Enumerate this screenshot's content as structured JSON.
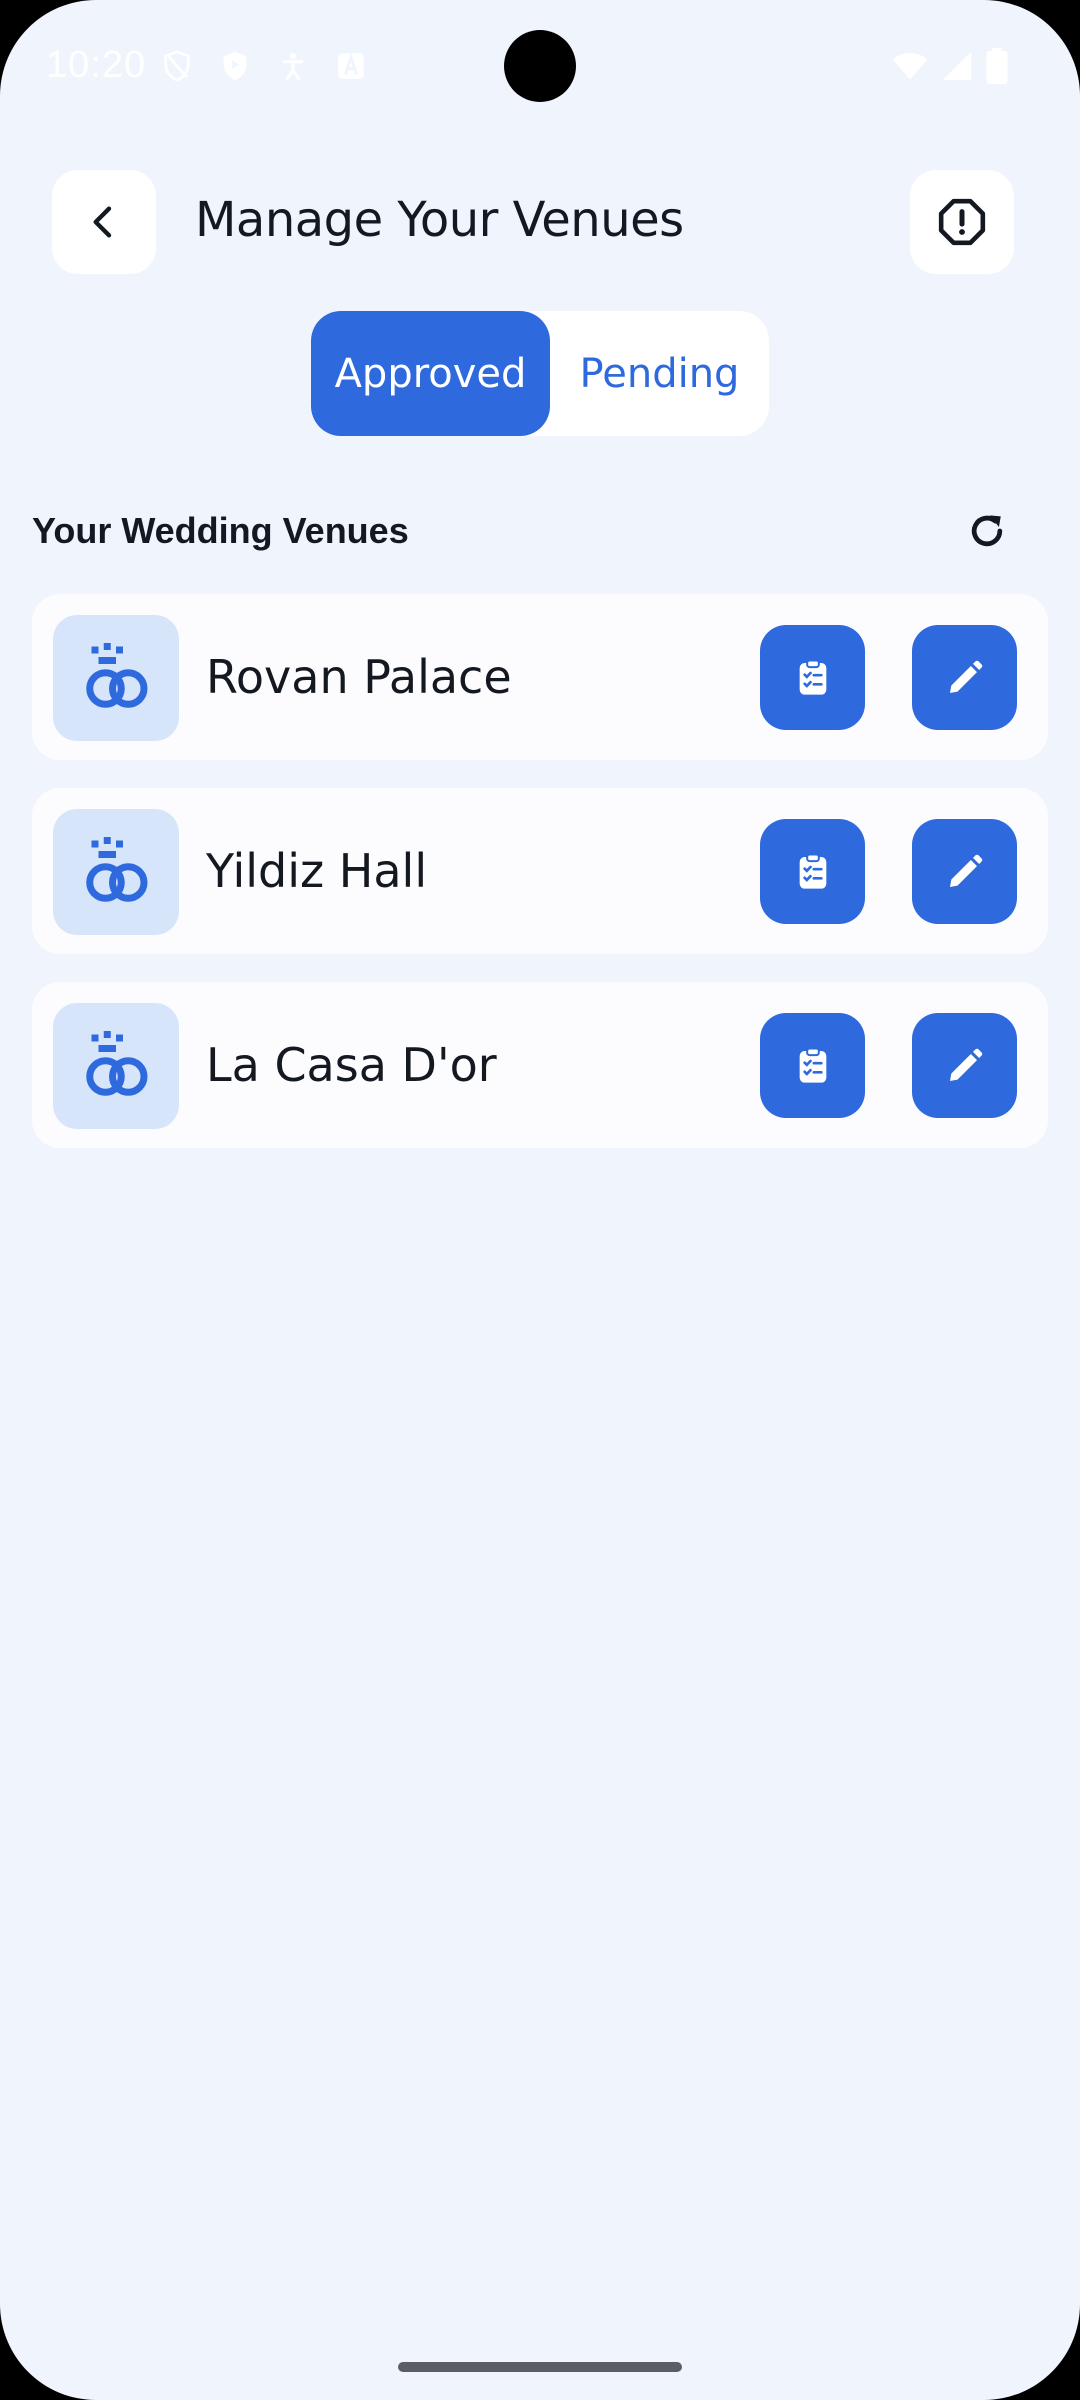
{
  "status_bar": {
    "time": "10:20",
    "icons": [
      "vpn-icon",
      "shield-icon",
      "accessibility-icon",
      "font-icon",
      "wifi-icon",
      "signal-icon",
      "battery-icon"
    ]
  },
  "header": {
    "title": "Manage Your Venues",
    "back_icon": "chevron-left-icon",
    "report_icon": "alert-octagon-icon"
  },
  "tabs": {
    "items": [
      "Approved",
      "Pending"
    ],
    "selected": "Approved"
  },
  "section": {
    "title": "Your Wedding Venues",
    "refresh_icon": "refresh-icon"
  },
  "venues": [
    {
      "name": "Rovan Palace"
    },
    {
      "name": "Yildiz Hall"
    },
    {
      "name": "La Casa D'or"
    }
  ],
  "colors": {
    "background": "#f0f4fd",
    "accent": "#2e6add",
    "thumb_bg": "#d7e5fb",
    "card_bg": "#fcfcfe",
    "text": "#141821"
  }
}
